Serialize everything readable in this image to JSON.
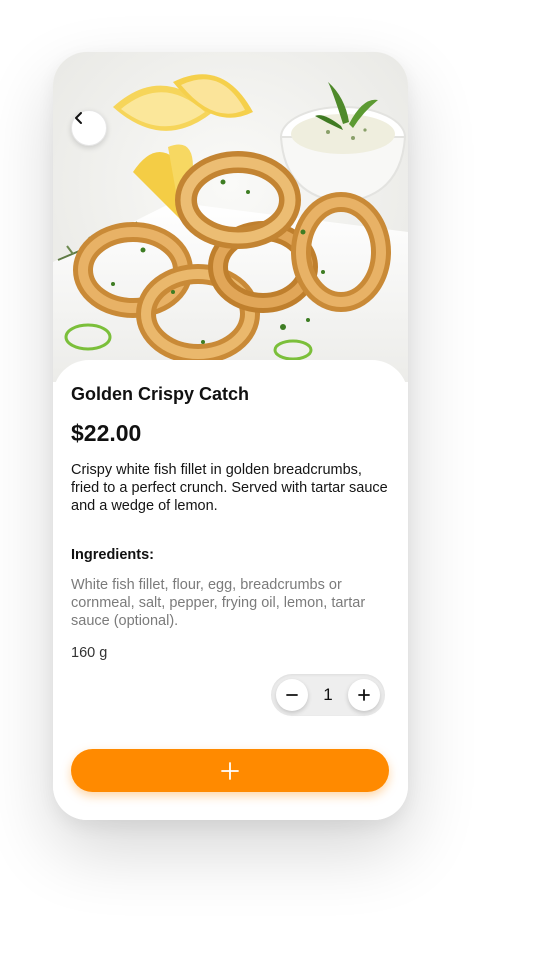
{
  "product": {
    "title": "Golden Crispy Catch",
    "price": "$22.00",
    "description": "Crispy white fish fillet in golden breadcrumbs, fried to a perfect crunch. Served with tartar sauce and a wedge of lemon.",
    "ingredients_label": "Ingredients:",
    "ingredients": "White fish fillet, flour, egg, breadcrumbs or cornmeal, salt, pepper, frying oil, lemon, tartar sauce (optional).",
    "weight": "160 g"
  },
  "quantity": {
    "value": "1"
  },
  "icons": {
    "back": "chevron-left-icon",
    "minus": "minus-icon",
    "plus": "plus-icon",
    "add_to_cart": "plus-icon"
  },
  "colors": {
    "accent": "#ff8a00",
    "text": "#111111",
    "muted": "#7b7b7b"
  }
}
